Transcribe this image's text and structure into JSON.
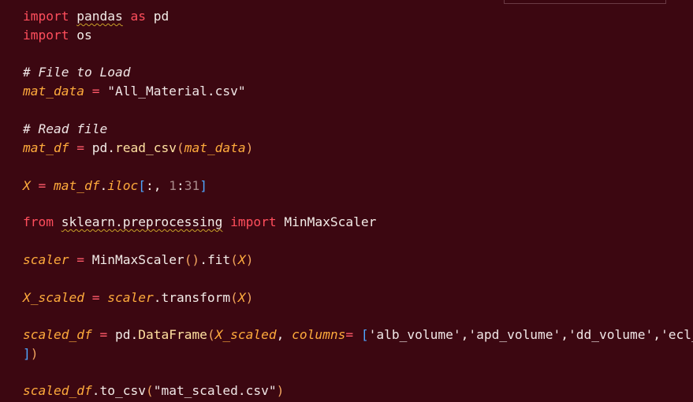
{
  "colors": {
    "background": "#3c0711",
    "keyword": "#ff4e5c",
    "variable": "#ffab3c",
    "comment": "#f0e6e6",
    "number": "#a88a8a",
    "bracket_square": "#4fa6ff",
    "paren": "#f0a35e",
    "warning_squiggle": "#c9a227"
  },
  "code": {
    "line1": {
      "kw_import": "import",
      "module": "pandas",
      "kw_as": "as",
      "alias": "pd"
    },
    "line2": {
      "kw_import": "import",
      "module": "os"
    },
    "line4": {
      "comment": "# File to Load"
    },
    "line5": {
      "var": "mat_data",
      "eq": " = ",
      "str": "\"All_Material.csv\""
    },
    "line7": {
      "comment": "# Read file"
    },
    "line8": {
      "var": "mat_df",
      "eq": " = ",
      "obj": "pd",
      "dot": ".",
      "fn": "read_csv",
      "lp": "(",
      "arg": "mat_data",
      "rp": ")"
    },
    "line10": {
      "var": "X",
      "eq": " = ",
      "obj": "mat_df",
      "dot": ".",
      "attr": "iloc",
      "lb": "[",
      "mid": ":, ",
      "n1": "1",
      "colon": ":",
      "n2": "31",
      "rb": "]"
    },
    "line12": {
      "kw_from": "from",
      "module": "sklearn.preprocessing",
      "kw_import": "import",
      "name": "MinMaxScaler"
    },
    "line14": {
      "var": "scaler",
      "eq": " = ",
      "call": "MinMaxScaler",
      "parens": "()",
      "dot": ".",
      "fn": "fit",
      "lp": "(",
      "arg": "X",
      "rp": ")"
    },
    "line16": {
      "var": "X_scaled",
      "eq": " = ",
      "obj": "scaler",
      "dot": ".",
      "fn": "transform",
      "lp": "(",
      "arg": "X",
      "rp": ")"
    },
    "line18": {
      "var": "scaled_df",
      "eq": " = ",
      "obj": "pd",
      "dot": ".",
      "fn": "DataFrame",
      "lp": "(",
      "arg": "X_scaled",
      "comma": ", ",
      "kwarg": "columns",
      "keq": "= ",
      "lb": "[",
      "s1": "'alb_volume'",
      "c1": ",",
      "s2": "'apd_volume'",
      "c2": ",",
      "s3": "'dd_volume'",
      "c3": ",",
      "s4": "'ecl_"
    },
    "line19": {
      "rb": "]",
      "rp": ")"
    },
    "line21": {
      "obj": "scaled_df",
      "dot": ".",
      "fn": "to_csv",
      "lp": "(",
      "str": "\"mat_scaled.csv\"",
      "rp": ")"
    }
  }
}
